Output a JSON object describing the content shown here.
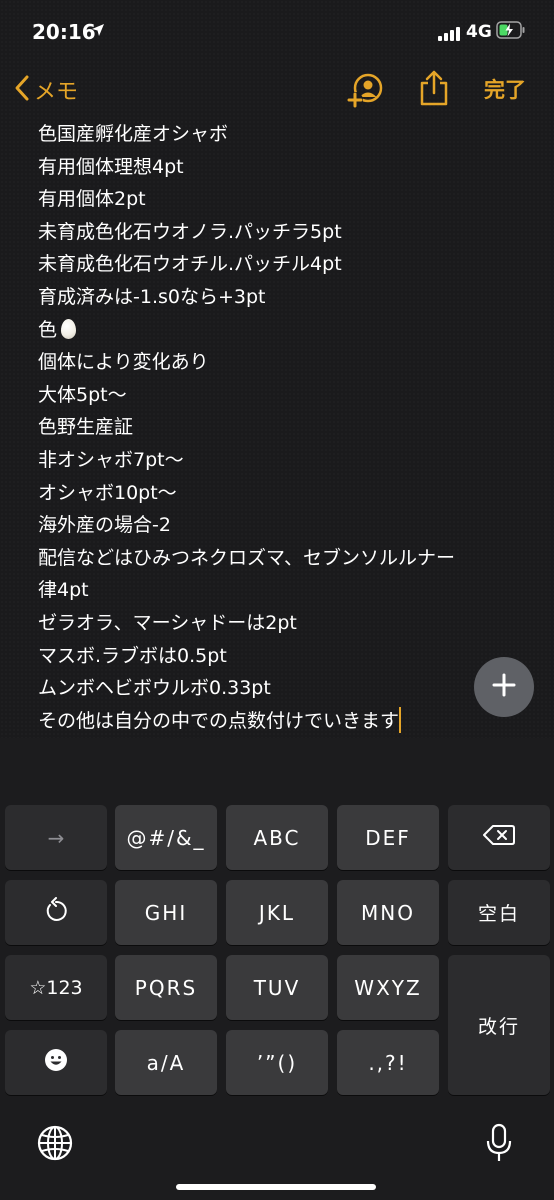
{
  "status_bar": {
    "time": "20:16",
    "network": "4G"
  },
  "nav": {
    "back_label": "メモ",
    "done_label": "完了"
  },
  "note": {
    "lines": [
      "色国産孵化産オシャボ",
      "有用個体理想4pt",
      "有用個体2pt",
      "未育成色化石ウオノラ.パッチラ5pt",
      "未育成色化石ウオチル.パッチル4pt",
      "育成済みは-1.s0なら+3pt",
      "色",
      "個体により変化あり",
      "大体5pt〜",
      "色野生産証",
      "非オシャボ7pt〜",
      "オシャボ10pt〜",
      "海外産の場合-2",
      "配信などはひみつネクロズマ、セブンソルルナー",
      "律4pt",
      "ゼラオラ、マーシャドーは2pt",
      "マスボ.ラブボは0.5pt",
      "ムンボヘビボウルボ0.33pt",
      "その他は自分の中での点数付けでいきます"
    ],
    "emoji_after_line_7": "egg"
  },
  "keyboard": {
    "keys": {
      "arrow": "→",
      "symbols": "@#/&_",
      "abc": "ABC",
      "def": "DEF",
      "ghi": "GHI",
      "jkl": "JKL",
      "mno": "MNO",
      "space": "空白",
      "num": "☆123",
      "pqrs": "PQRS",
      "tuv": "TUV",
      "wxyz": "WXYZ",
      "return": "改行",
      "case": "a/A",
      "quotes": "’”()",
      "punct": ".,?!"
    }
  },
  "colors": {
    "accent": "#e5a528",
    "key": "#3a3a3c",
    "key_dark": "#2c2c2e",
    "background": "#1a1a1c"
  },
  "icons": [
    "location-arrow-icon",
    "signal-icon",
    "battery-charging-icon",
    "chevron-left-icon",
    "add-person-icon",
    "share-icon",
    "plus-icon",
    "backspace-icon",
    "undo-icon",
    "emoji-icon",
    "globe-icon",
    "microphone-icon"
  ]
}
